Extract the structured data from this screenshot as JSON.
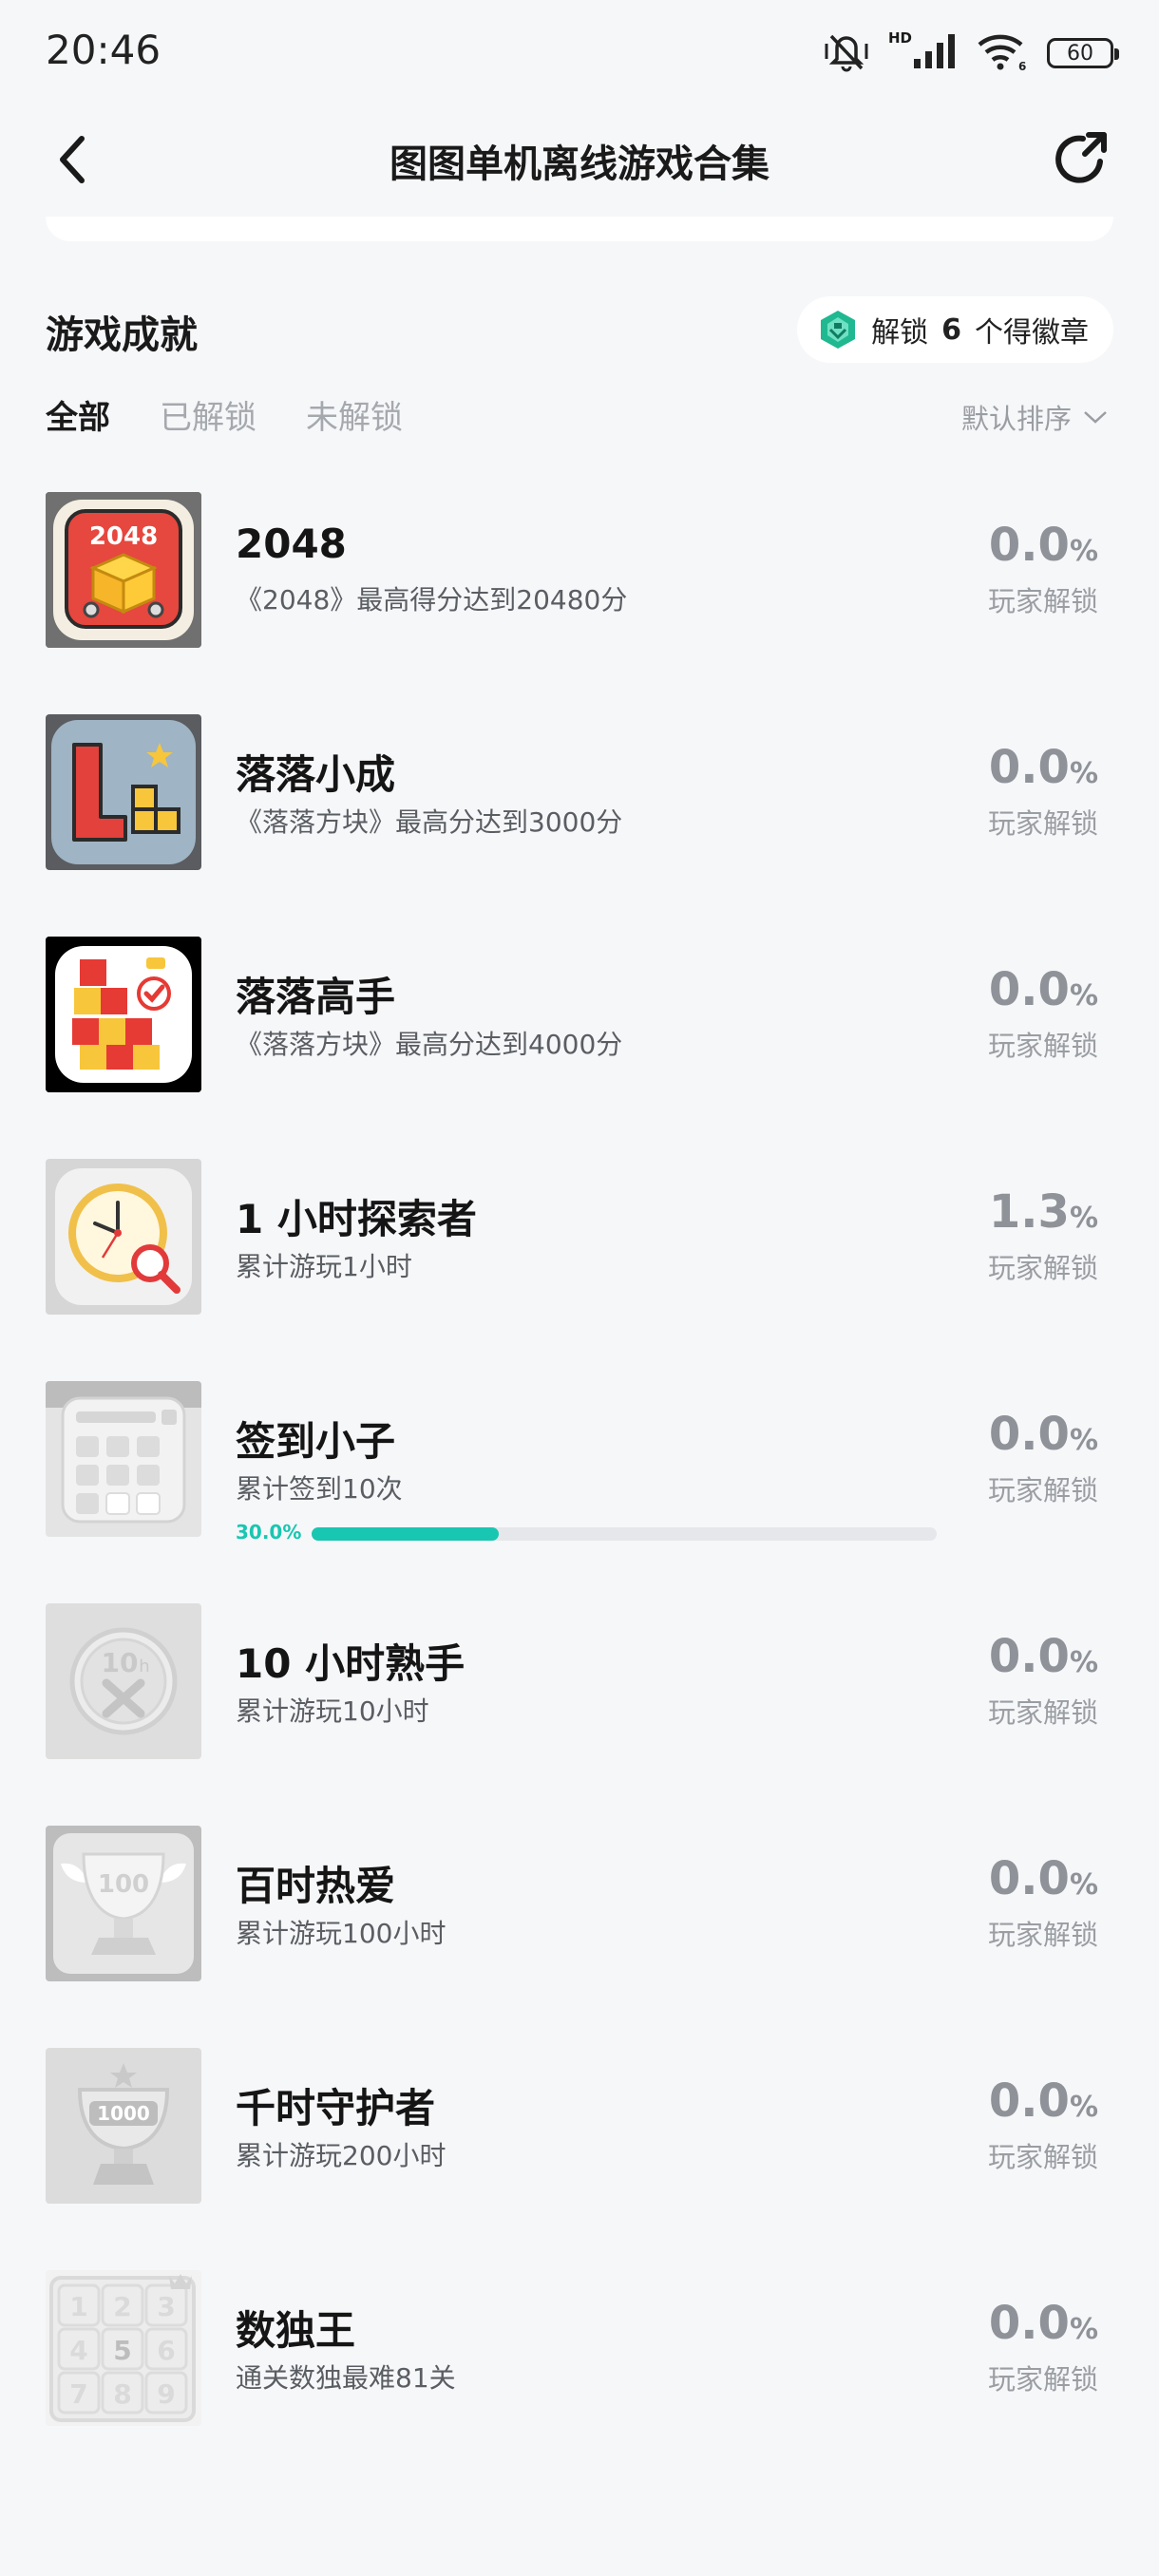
{
  "status": {
    "time": "20:46",
    "hd": "HD",
    "battery": "60"
  },
  "header": {
    "title": "图图单机离线游戏合集"
  },
  "section": {
    "title": "游戏成就",
    "badge_prefix": "解锁",
    "badge_count": "6",
    "badge_suffix": "个得徽章"
  },
  "tabs": [
    {
      "label": "全部",
      "active": true
    },
    {
      "label": "已解锁",
      "active": false
    },
    {
      "label": "未解锁",
      "active": false
    }
  ],
  "sort": {
    "label": "默认排序"
  },
  "achievements": [
    {
      "name": "2048",
      "desc": "《2048》最高得分达到20480分",
      "pct": "0.0",
      "pct_symbol": "%",
      "pct_label": "玩家解锁",
      "icon": "2048-cube-icon"
    },
    {
      "name": "落落小成",
      "desc": "《落落方块》最高分达到3000分",
      "pct": "0.0",
      "pct_symbol": "%",
      "pct_label": "玩家解锁",
      "icon": "l-block-icon"
    },
    {
      "name": "落落高手",
      "desc": "《落落方块》最高分达到4000分",
      "pct": "0.0",
      "pct_symbol": "%",
      "pct_label": "玩家解锁",
      "icon": "letter-blocks-icon"
    },
    {
      "name": "1 小时探索者",
      "desc": "累计游玩1小时",
      "pct": "1.3",
      "pct_symbol": "%",
      "pct_label": "玩家解锁",
      "icon": "clock-search-icon"
    },
    {
      "name": "签到小子",
      "desc": "累计签到10次",
      "progress_label": "30.0%",
      "progress": 0.3,
      "pct": "0.0",
      "pct_symbol": "%",
      "pct_label": "玩家解锁",
      "icon": "calendar-icon"
    },
    {
      "name": "10 小时熟手",
      "desc": "累计游玩10小时",
      "pct": "0.0",
      "pct_symbol": "%",
      "pct_label": "玩家解锁",
      "icon": "wrench-medal-icon"
    },
    {
      "name": "百时热爱",
      "desc": "累计游玩100小时",
      "pct": "0.0",
      "pct_symbol": "%",
      "pct_label": "玩家解锁",
      "icon": "trophy-100-icon",
      "icon_text": "100"
    },
    {
      "name": "千时守护者",
      "desc": "累计游玩200小时",
      "pct": "0.0",
      "pct_symbol": "%",
      "pct_label": "玩家解锁",
      "icon": "trophy-1000-icon",
      "icon_text": "1000"
    },
    {
      "name": "数独王",
      "desc": "通关数独最难81关",
      "pct": "0.0",
      "pct_symbol": "%",
      "pct_label": "玩家解锁",
      "icon": "sudoku-grid-icon"
    }
  ],
  "colors": {
    "accent": "#19c6b1",
    "background": "#f6f7f9",
    "badge_green": "#1fb890"
  }
}
